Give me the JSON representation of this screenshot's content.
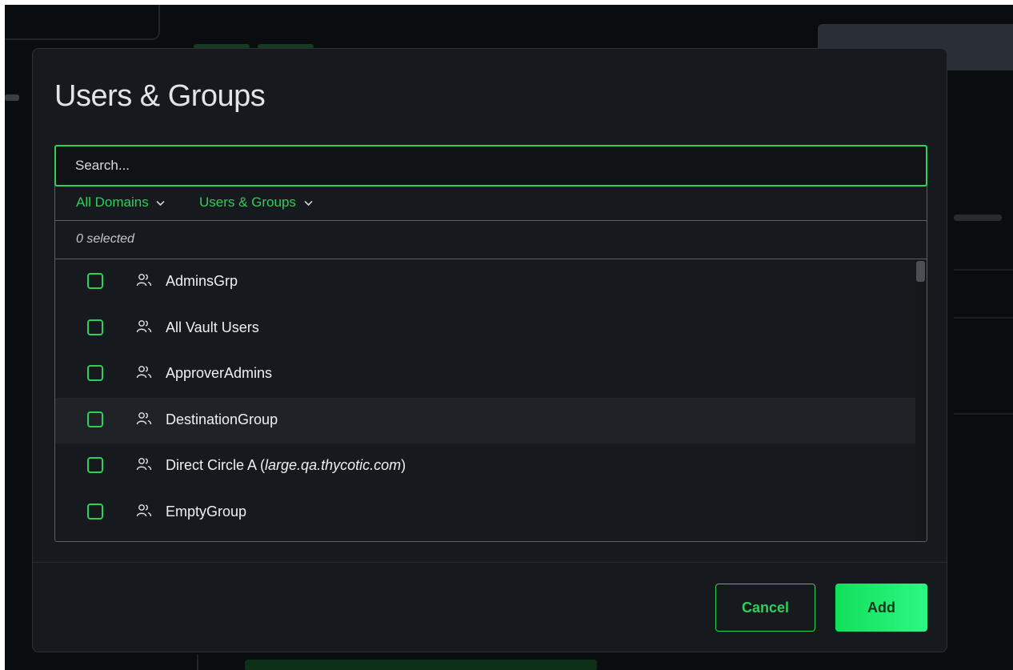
{
  "dialog": {
    "title": "Users & Groups",
    "search_placeholder": "Search...",
    "filters": {
      "domain": "All Domains",
      "type": "Users & Groups"
    },
    "selected_count": "0 selected",
    "items": [
      {
        "name": "AdminsGrp",
        "domain": "",
        "icon": "group-icon"
      },
      {
        "name": "All Vault Users",
        "domain": "",
        "icon": "group-icon"
      },
      {
        "name": "ApproverAdmins",
        "domain": "",
        "icon": "group-icon"
      },
      {
        "name": "DestinationGroup",
        "domain": "",
        "icon": "group-icon"
      },
      {
        "name": "Direct Circle A (",
        "domain": "large.qa.thycotic.com",
        "suffix": ")",
        "icon": "group-icon"
      },
      {
        "name": "EmptyGroup",
        "domain": "",
        "icon": "group-icon"
      }
    ],
    "buttons": {
      "cancel": "Cancel",
      "add": "Add"
    }
  },
  "colors": {
    "accent": "#2ecf5a",
    "modal_bg": "#16191d",
    "backdrop": "#0a0d10"
  }
}
